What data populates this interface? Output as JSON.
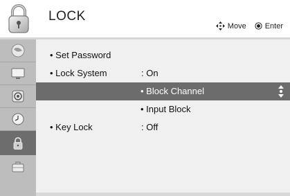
{
  "header": {
    "title": "LOCK",
    "icon": "padlock-icon",
    "hints": [
      {
        "icon": "four-way-arrow-icon",
        "label": "Move"
      },
      {
        "icon": "ok-button-icon",
        "label": "Enter"
      }
    ]
  },
  "sidebar": {
    "items": [
      {
        "icon": "satellite-dish-icon",
        "active": false
      },
      {
        "icon": "picture-monitor-icon",
        "active": false
      },
      {
        "icon": "speaker-icon",
        "active": false
      },
      {
        "icon": "clock-icon",
        "active": false
      },
      {
        "icon": "padlock-icon",
        "active": true
      },
      {
        "icon": "option-briefcase-icon",
        "active": false
      }
    ]
  },
  "menu": {
    "items": [
      {
        "label": "• Set Password",
        "value": ""
      },
      {
        "label": "• Lock System",
        "value": ": On"
      },
      {
        "sublabel": "• Block Channel",
        "selected": true
      },
      {
        "sublabel": "• Input Block",
        "selected": false
      },
      {
        "label": "• Key Lock",
        "value": ": Off"
      }
    ]
  },
  "colors": {
    "selected_row": "#6c6c6c",
    "sidebar": "#bdbdbd",
    "sidebar_active": "#6d6d6d",
    "panel": "#f0f0f0"
  }
}
